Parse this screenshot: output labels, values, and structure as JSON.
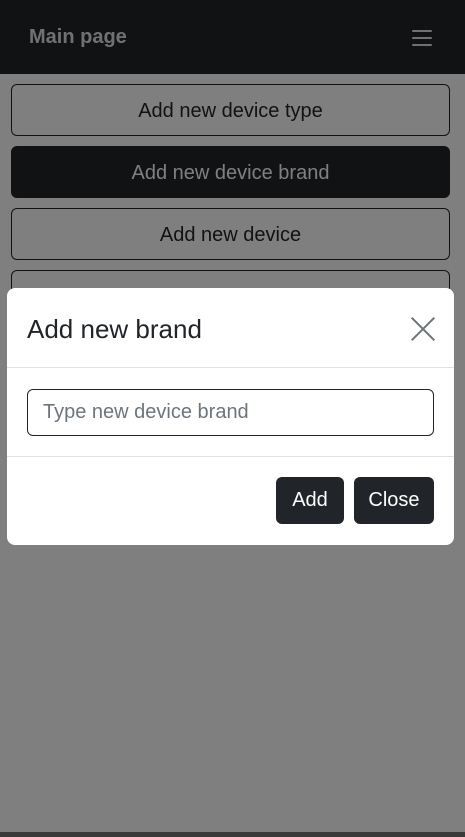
{
  "navbar": {
    "brand": "Main page",
    "toggler_icon": "hamburger-menu-icon"
  },
  "actions": [
    {
      "label": "Add new device type"
    },
    {
      "label": "Add new device brand"
    },
    {
      "label": "Add new device"
    },
    {
      "label": ""
    }
  ],
  "modal": {
    "title": "Add new brand",
    "close_icon": "close-icon",
    "input": {
      "value": "",
      "placeholder": "Type new device brand"
    },
    "add_label": "Add",
    "close_label": "Close"
  },
  "colors": {
    "dark": "#212529",
    "navbar_text": "#dee2e6",
    "backdrop": "rgba(0,0,0,0.5)"
  }
}
